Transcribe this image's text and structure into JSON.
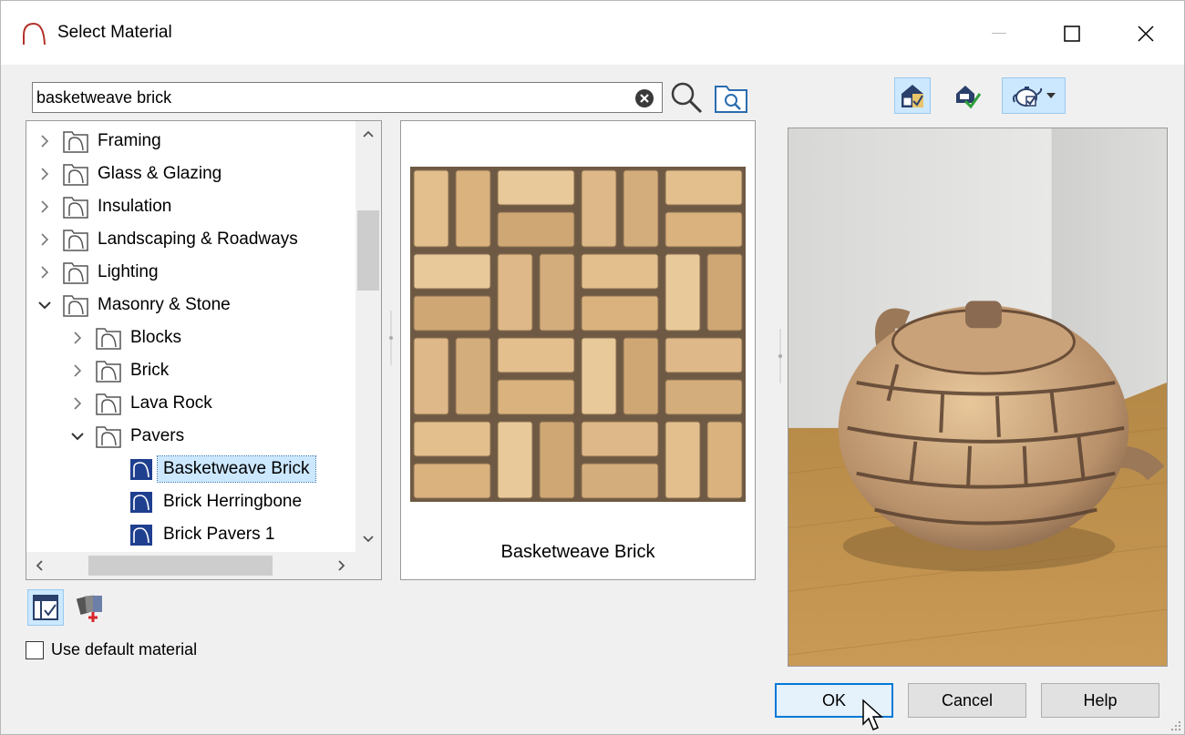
{
  "window": {
    "title": "Select Material"
  },
  "search": {
    "value": "basketweave brick",
    "placeholder": ""
  },
  "tree": {
    "items": [
      {
        "label": "Framing",
        "level": 0,
        "expanded": false,
        "type": "folder"
      },
      {
        "label": "Glass & Glazing",
        "level": 0,
        "expanded": false,
        "type": "folder"
      },
      {
        "label": "Insulation",
        "level": 0,
        "expanded": false,
        "type": "folder"
      },
      {
        "label": "Landscaping & Roadways",
        "level": 0,
        "expanded": false,
        "type": "folder"
      },
      {
        "label": "Lighting",
        "level": 0,
        "expanded": false,
        "type": "folder"
      },
      {
        "label": "Masonry & Stone",
        "level": 0,
        "expanded": true,
        "type": "folder"
      },
      {
        "label": "Blocks",
        "level": 1,
        "expanded": false,
        "type": "folder"
      },
      {
        "label": "Brick",
        "level": 1,
        "expanded": false,
        "type": "folder"
      },
      {
        "label": "Lava Rock",
        "level": 1,
        "expanded": false,
        "type": "folder"
      },
      {
        "label": "Pavers",
        "level": 1,
        "expanded": true,
        "type": "folder"
      },
      {
        "label": "Basketweave Brick",
        "level": 2,
        "type": "material",
        "selected": true
      },
      {
        "label": "Brick Herringbone",
        "level": 2,
        "type": "material"
      },
      {
        "label": "Brick Pavers 1",
        "level": 2,
        "type": "material"
      }
    ]
  },
  "preview": {
    "caption": "Basketweave Brick"
  },
  "options": {
    "use_default_label": "Use default material",
    "use_default_checked": false
  },
  "buttons": {
    "ok": "OK",
    "cancel": "Cancel",
    "help": "Help"
  },
  "colors": {
    "accent": "#0078d7",
    "selection": "#cce8ff",
    "material_icon": "#1f3f8f"
  }
}
